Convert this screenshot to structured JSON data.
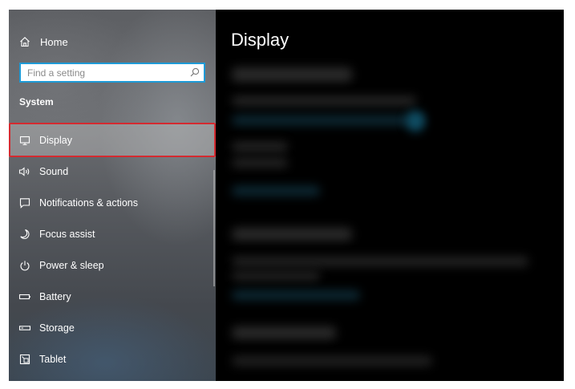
{
  "sidebar": {
    "home_label": "Home",
    "search": {
      "placeholder": "Find a setting"
    },
    "section_title": "System",
    "items": [
      {
        "label": "Display",
        "icon": "monitor-icon",
        "selected": true
      },
      {
        "label": "Sound",
        "icon": "speaker-icon"
      },
      {
        "label": "Notifications & actions",
        "icon": "notification-icon"
      },
      {
        "label": "Focus assist",
        "icon": "moon-icon"
      },
      {
        "label": "Power & sleep",
        "icon": "power-icon"
      },
      {
        "label": "Battery",
        "icon": "battery-icon"
      },
      {
        "label": "Storage",
        "icon": "storage-icon"
      },
      {
        "label": "Tablet",
        "icon": "tablet-icon"
      }
    ]
  },
  "content": {
    "title": "Display"
  },
  "colors": {
    "search_border": "#1e9ad6",
    "highlight_border": "#d42a30",
    "content_background": "#000000",
    "text": "#ffffff"
  }
}
